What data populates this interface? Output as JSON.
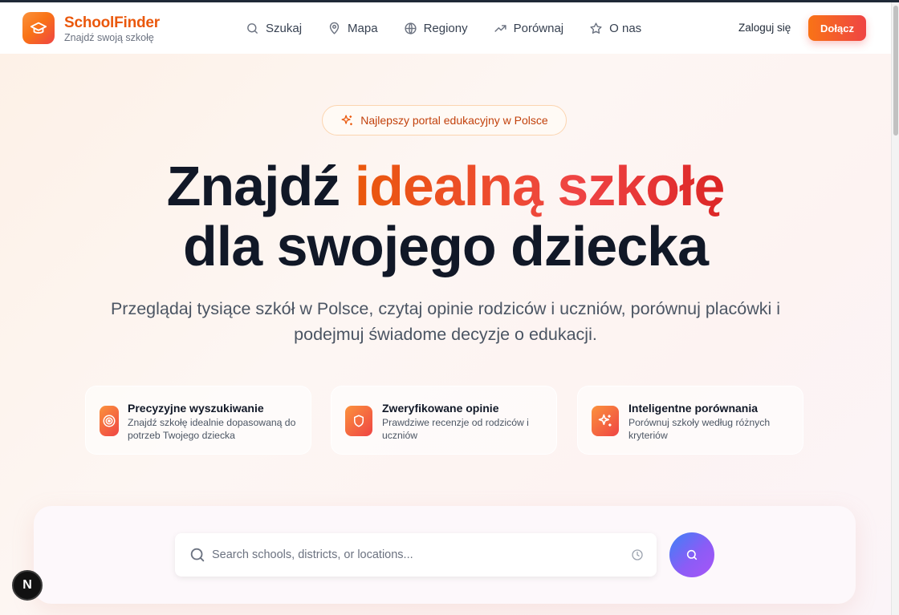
{
  "header": {
    "brand": "SchoolFinder",
    "tagline": "Znajdź swoją szkołę",
    "nav": [
      {
        "label": "Szukaj",
        "icon": "search-icon"
      },
      {
        "label": "Mapa",
        "icon": "map-pin-icon"
      },
      {
        "label": "Regiony",
        "icon": "globe-icon"
      },
      {
        "label": "Porównaj",
        "icon": "trending-up-icon"
      },
      {
        "label": "O nas",
        "icon": "star-icon"
      }
    ],
    "login_label": "Zaloguj się",
    "join_label": "Dołącz"
  },
  "hero": {
    "badge": "Najlepszy portal edukacyjny w Polsce",
    "title_part1": "Znajdź ",
    "title_accent": "idealną szkołę",
    "title_line2": "dla swojego dziecka",
    "subtitle_line1": "Przeglądaj tysiące szkół w Polsce, czytaj opinie rodziców i uczniów, porównuj placówki i",
    "subtitle_line2": "podejmuj świadome decyzje o edukacji."
  },
  "features": [
    {
      "title": "Precyzyjne wyszukiwanie",
      "desc": "Znajdź szkołę idealnie dopasowaną do potrzeb Twojego dziecka",
      "icon": "target-icon"
    },
    {
      "title": "Zweryfikowane opinie",
      "desc": "Prawdziwe recenzje od rodziców i uczniów",
      "icon": "shield-icon"
    },
    {
      "title": "Inteligentne porównania",
      "desc": "Porównuj szkoły według różnych kryteriów",
      "icon": "sparkles-icon"
    }
  ],
  "search": {
    "placeholder": "Search schools, districts, or locations..."
  },
  "dev_badge": "N",
  "colors": {
    "brand": "#ea580c",
    "accent_gradient_start": "#f97316",
    "accent_gradient_end": "#ef4444",
    "search_button_start": "#3b82f6",
    "search_button_end": "#a855f7"
  }
}
